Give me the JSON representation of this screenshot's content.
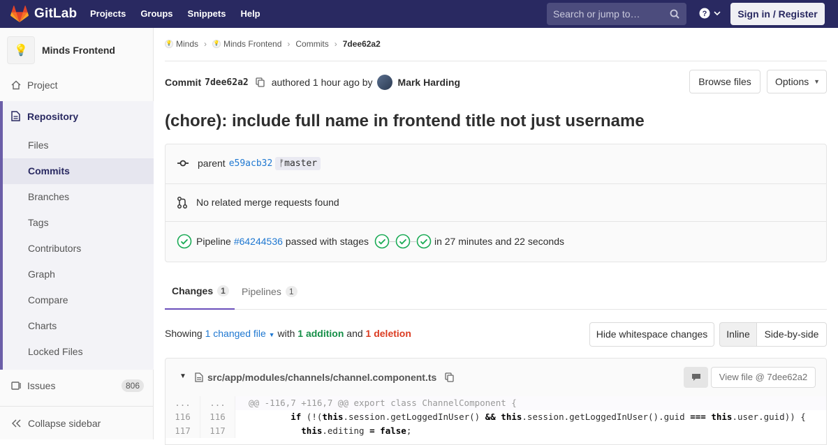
{
  "topbar": {
    "brand": "GitLab",
    "nav": [
      "Projects",
      "Groups",
      "Snippets",
      "Help"
    ],
    "search_placeholder": "Search or jump to…",
    "signin": "Sign in / Register"
  },
  "sidebar": {
    "project_name": "Minds Frontend",
    "project": "Project",
    "repository": "Repository",
    "sub_items": [
      "Files",
      "Commits",
      "Branches",
      "Tags",
      "Contributors",
      "Graph",
      "Compare",
      "Charts",
      "Locked Files"
    ],
    "issues": "Issues",
    "issues_count": "806",
    "collapse": "Collapse sidebar"
  },
  "breadcrumb": [
    "Minds",
    "Minds Frontend",
    "Commits",
    "7dee62a2"
  ],
  "commit": {
    "label": "Commit",
    "sha": "7dee62a2",
    "authored": "authored 1 hour ago by",
    "author": "Mark Harding",
    "browse_files": "Browse files",
    "options": "Options",
    "title": "(chore): include full name in frontend title not just username",
    "parent_label": "parent",
    "parent_sha": "e59acb32",
    "branch": "master",
    "merge_requests": "No related merge requests found",
    "pipeline_label": "Pipeline",
    "pipeline_id": "#64244536",
    "pipeline_status": "passed with stages",
    "pipeline_duration": "in 27 minutes and 22 seconds"
  },
  "tabs": {
    "changes": "Changes",
    "changes_count": "1",
    "pipelines": "Pipelines",
    "pipelines_count": "1"
  },
  "summary": {
    "showing": "Showing",
    "changed_files": "1 changed file",
    "with": "with",
    "additions": "1 addition",
    "and": "and",
    "deletions": "1 deletion",
    "hide_whitespace": "Hide whitespace changes",
    "inline": "Inline",
    "side_by_side": "Side-by-side"
  },
  "file": {
    "path": "src/app/modules/channels/channel.component.ts",
    "view_file": "View file @ 7dee62a2"
  },
  "diff": {
    "hunk_old": "...",
    "hunk_new": "...",
    "hunk_text": "@@ -116,7 +116,7 @@ export class ChannelComponent {",
    "lines": [
      {
        "old": "116",
        "new": "116"
      },
      {
        "old": "117",
        "new": "117"
      }
    ]
  }
}
